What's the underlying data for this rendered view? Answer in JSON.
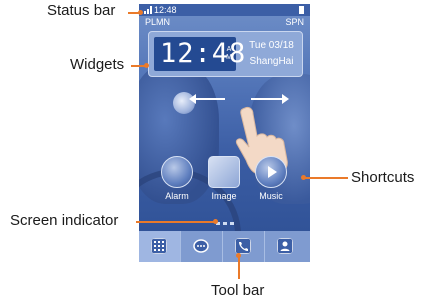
{
  "status_bar": {
    "time": "12:48",
    "operator_left": "PLMN",
    "operator_right": "SPN"
  },
  "widget": {
    "time_digits": "12:48",
    "ampm": "AM",
    "date": "Tue 03/18",
    "city": "ShangHai"
  },
  "shortcuts": [
    {
      "label": "Alarm",
      "icon": "alarm-icon"
    },
    {
      "label": "Image",
      "icon": "image-icon"
    },
    {
      "label": "Music",
      "icon": "music-play-icon"
    }
  ],
  "toolbar": {
    "items": [
      {
        "icon": "apps-grid-icon"
      },
      {
        "icon": "message-icon"
      },
      {
        "icon": "phone-icon"
      },
      {
        "icon": "contacts-icon"
      }
    ]
  },
  "callouts": {
    "status_bar": "Status bar",
    "widgets": "Widgets",
    "shortcuts": "Shortcuts",
    "screen_indicator": "Screen indicator",
    "tool_bar": "Tool bar"
  },
  "colors": {
    "accent": "#ea7a2a",
    "screen_blue": "#3c5fa6",
    "clock_bg": "#244a92"
  }
}
